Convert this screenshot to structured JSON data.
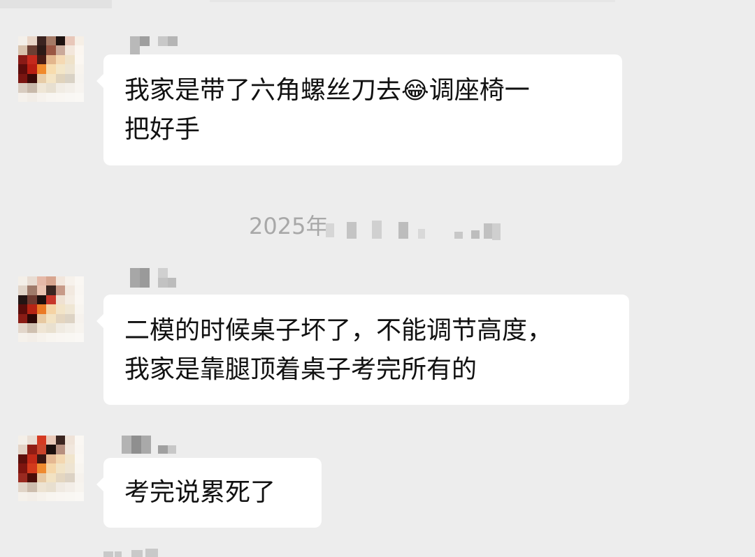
{
  "chat": {
    "messages": [
      {
        "lines": [
          "我家是带了六角螺丝刀去",
          "调座椅一",
          "把好手"
        ],
        "emoji": "😂",
        "emoji_name": "face-with-tears-of-joy"
      },
      {
        "lines": [
          "二模的时候桌子坏了，不能调节高度，",
          "我家是靠腿顶着桌子考完所有的"
        ]
      },
      {
        "lines": [
          "考完说累死了"
        ]
      }
    ],
    "time_separator": "2025年"
  },
  "colors": {
    "background": "#ededed",
    "bubble": "#ffffff",
    "text": "#111111",
    "time_text": "#a8a8a8"
  }
}
